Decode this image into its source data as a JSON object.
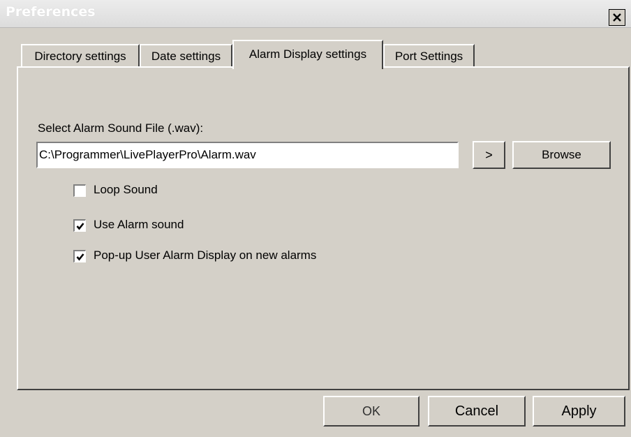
{
  "window": {
    "title": "Preferences",
    "close_glyph": "×"
  },
  "tabs": [
    {
      "label": "Directory settings",
      "active": false
    },
    {
      "label": "Date settings",
      "active": false
    },
    {
      "label": "Alarm Display settings",
      "active": true
    },
    {
      "label": "Port Settings",
      "active": false
    }
  ],
  "alarm": {
    "file_label": "Select Alarm Sound File (.wav):",
    "file_value": "C:\\Programmer\\LivePlayerPro\\Alarm.wav",
    "arrow_button": ">",
    "browse_button": "Browse",
    "options": [
      {
        "label": "Loop Sound",
        "checked": false
      },
      {
        "label": "Use Alarm sound",
        "checked": true
      },
      {
        "label": "Pop-up User Alarm Display on new alarms",
        "checked": true
      }
    ]
  },
  "footer": {
    "ok": "OK",
    "cancel": "Cancel",
    "apply": "Apply"
  },
  "icons": {
    "close": "close-icon",
    "check": "check-icon"
  }
}
